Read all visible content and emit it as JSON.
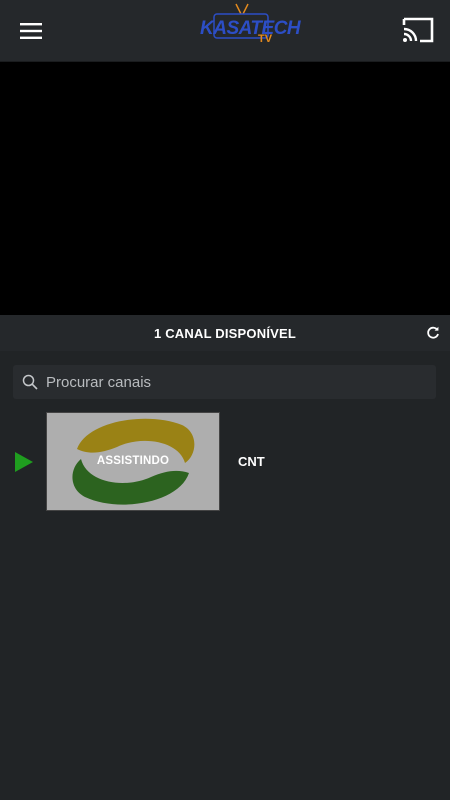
{
  "header": {
    "logo_text": "KASATECH",
    "logo_sub": "TV",
    "menu_icon": "hamburger-menu-icon",
    "cast_icon": "cast-icon"
  },
  "channels_header": {
    "count_label": "1 CANAL DISPONÍVEL",
    "refresh_icon": "refresh-icon"
  },
  "search": {
    "placeholder": "Procurar canais",
    "value": ""
  },
  "channels": [
    {
      "name": "CNT",
      "status_label": "ASSISTINDO",
      "playing": true
    }
  ],
  "colors": {
    "background": "#212426",
    "appbar": "#25282b",
    "play_indicator": "#1f9d1f",
    "logo_blue": "#2c4ec6",
    "logo_orange": "#e48a1e"
  }
}
